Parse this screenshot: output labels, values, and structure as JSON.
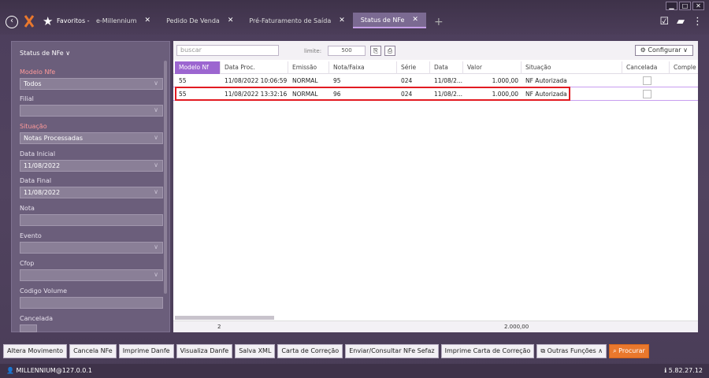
{
  "window": {
    "min": "▁",
    "max": "□",
    "close": "✕"
  },
  "header": {
    "favorites": "Favoritos -",
    "tabs": [
      {
        "label": "e-Millennium",
        "close": "✕"
      },
      {
        "label": "Pedido De Venda",
        "close": "✕"
      },
      {
        "label": "Pré-Faturamento de Saída",
        "close": "✕"
      },
      {
        "label": "Status de NFe",
        "close": "✕"
      }
    ],
    "add_tab": "+"
  },
  "filters": {
    "title": "Status de NFe",
    "modelo_label": "Modelo Nfe",
    "modelo_value": "Todos",
    "filial_label": "Filial",
    "filial_value": "",
    "situacao_label": "Situação",
    "situacao_value": "Notas Processadas",
    "data_inicial_label": "Data Inicial",
    "data_inicial_value": "11/08/2022",
    "data_final_label": "Data Final",
    "data_final_value": "11/08/2022",
    "nota_label": "Nota",
    "evento_label": "Evento",
    "cfop_label": "Cfop",
    "codigo_volume_label": "Codigo Volume",
    "cancelada_label": "Cancelada"
  },
  "toolbar": {
    "search_placeholder": "buscar",
    "limite_label": "limite:",
    "limite_value": "500",
    "config_label": "⚙ Configurar ∨"
  },
  "grid": {
    "columns": [
      "Modelo Nf",
      "Data Proc.",
      "Emissão",
      "Nota/Faixa",
      "Série",
      "Data",
      "Valor",
      "Situação",
      "Cancelada",
      "Comple"
    ],
    "rows": [
      {
        "modelo": "55",
        "data_proc": "11/08/2022 10:06:59",
        "emissao": "NORMAL",
        "nota": "95",
        "serie": "024",
        "data": "11/08/2...",
        "valor": "1.000,00",
        "situacao": "NF Autorizada"
      },
      {
        "modelo": "55",
        "data_proc": "11/08/2022 13:32:16",
        "emissao": "NORMAL",
        "nota": "96",
        "serie": "024",
        "data": "11/08/2...",
        "valor": "1.000,00",
        "situacao": "NF Autorizada"
      }
    ],
    "footer_count": "2",
    "footer_total": "2.000,00"
  },
  "actions": [
    "Altera Movimento",
    "Cancela NFe",
    "Imprime Danfe",
    "Visualiza Danfe",
    "Salva XML",
    "Carta de Correção",
    "Enviar/Consultar NFe Sefaz",
    "Imprime Carta de Correção",
    "Outras Funções ∧",
    "Procurar"
  ],
  "status": {
    "user": "MILLENNIUM@127.0.0.1",
    "version": "5.82.27.12"
  }
}
